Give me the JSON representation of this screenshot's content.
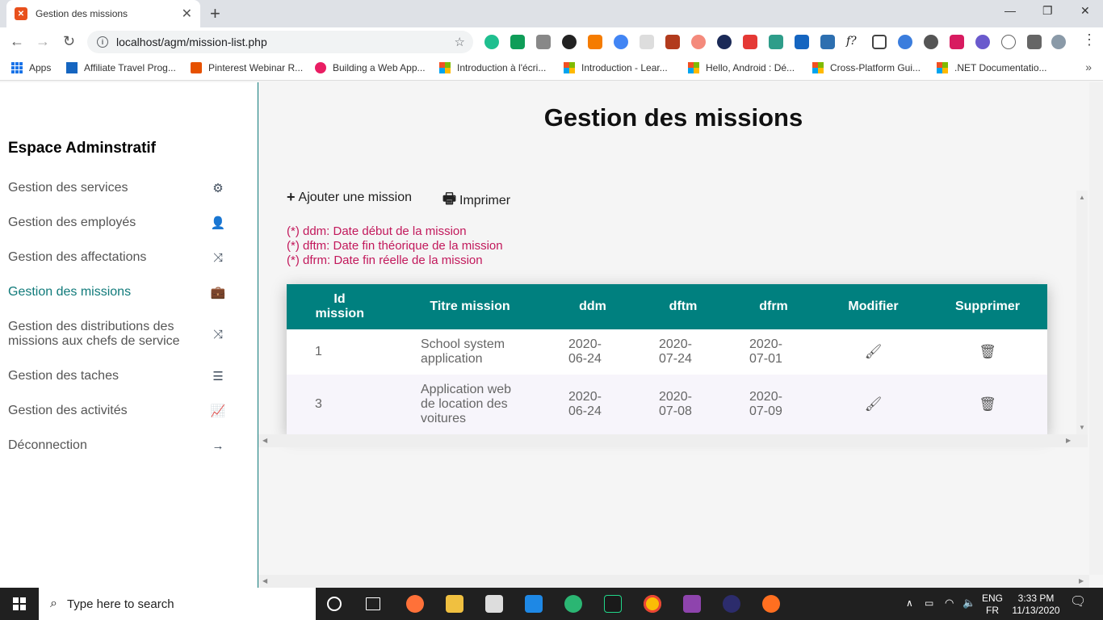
{
  "browser": {
    "tab_title": "Gestion des missions",
    "tab_close": "✕",
    "new_tab": "+",
    "url": "localhost/agm/mission-list.php",
    "bookmarks": [
      {
        "label": "Apps"
      },
      {
        "label": "Affiliate Travel Prog..."
      },
      {
        "label": "Pinterest Webinar R..."
      },
      {
        "label": "Building a Web App..."
      },
      {
        "label": "Introduction à l'écri..."
      },
      {
        "label": "Introduction - Lear..."
      },
      {
        "label": "Hello, Android : Dé..."
      },
      {
        "label": "Cross-Platform Gui..."
      },
      {
        "label": ".NET Documentatio..."
      }
    ]
  },
  "sidebar": {
    "brand": "Espace Adminstratif",
    "items": [
      {
        "label": "Gestion des services",
        "icon": "⚙"
      },
      {
        "label": "Gestion des employés",
        "icon": "👤"
      },
      {
        "label": "Gestion des affectations",
        "icon": "⤨"
      },
      {
        "label": "Gestion des missions",
        "icon": "💼"
      },
      {
        "label": "Gestion des distributions des missions aux chefs de service",
        "icon": "⤨"
      },
      {
        "label": "Gestion des taches",
        "icon": "☰"
      },
      {
        "label": "Gestion des activités",
        "icon": "📈"
      },
      {
        "label": "Déconnection",
        "icon": "→"
      }
    ]
  },
  "main": {
    "title": "Gestion des missions",
    "add_label": "Ajouter une mission",
    "print_label": "Imprimer",
    "legend": [
      "(*) ddm: Date début de la mission",
      "(*) dftm: Date fin théorique de la mission",
      "(*) dfrm: Date fin réelle de la mission"
    ],
    "table": {
      "headers": [
        "Id mission",
        "Titre mission",
        "ddm",
        "dftm",
        "dfrm",
        "Modifier",
        "Supprimer"
      ],
      "rows": [
        {
          "id": "1",
          "title": "School system application",
          "ddm": "2020-06-24",
          "dftm": "2020-07-24",
          "dfrm": "2020-07-01"
        },
        {
          "id": "3",
          "title": "Application web de location des voitures",
          "ddm": "2020-06-24",
          "dftm": "2020-07-08",
          "dfrm": "2020-07-09"
        }
      ]
    }
  },
  "taskbar": {
    "search_placeholder": "Type here to search",
    "lang_top": "ENG",
    "lang_bottom": "FR",
    "time": "3:33 PM",
    "date": "11/13/2020"
  },
  "colors": {
    "accent": "#107a7a",
    "table_header": "#00807f",
    "legend": "#c2185b"
  }
}
